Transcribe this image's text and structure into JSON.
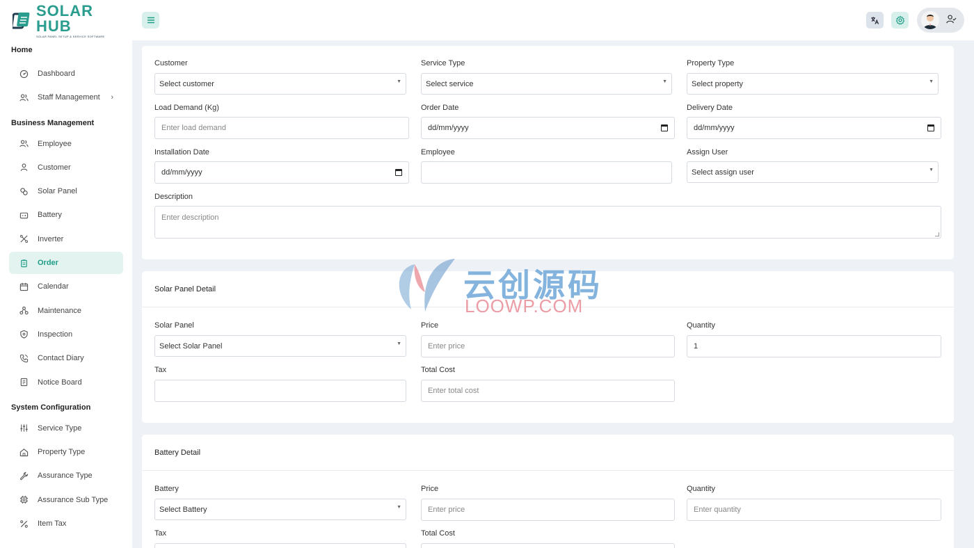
{
  "brand": {
    "name": "SOLAR HUB",
    "tagline": "SOLAR PANEL SETUP & SERVICE SOFTWARE",
    "color": "#2a9d8f"
  },
  "sidebar": {
    "sections": [
      {
        "title": "Home",
        "items": [
          {
            "label": "Dashboard",
            "icon": "dashboard-icon"
          },
          {
            "label": "Staff Management",
            "icon": "users-icon",
            "chevron": "›"
          }
        ]
      },
      {
        "title": "Business Management",
        "items": [
          {
            "label": "Employee",
            "icon": "users-icon"
          },
          {
            "label": "Customer",
            "icon": "user-icon"
          },
          {
            "label": "Solar Panel",
            "icon": "solar-panel-icon"
          },
          {
            "label": "Battery",
            "icon": "battery-icon"
          },
          {
            "label": "Inverter",
            "icon": "inverter-icon"
          },
          {
            "label": "Order",
            "icon": "clipboard-icon",
            "active": true
          },
          {
            "label": "Calendar",
            "icon": "calendar-icon"
          },
          {
            "label": "Maintenance",
            "icon": "maintenance-icon"
          },
          {
            "label": "Inspection",
            "icon": "shield-icon"
          },
          {
            "label": "Contact Diary",
            "icon": "phone-icon"
          },
          {
            "label": "Notice Board",
            "icon": "notice-icon"
          }
        ]
      },
      {
        "title": "System Configuration",
        "items": [
          {
            "label": "Service Type",
            "icon": "sliders-icon"
          },
          {
            "label": "Property Type",
            "icon": "home-icon"
          },
          {
            "label": "Assurance Type",
            "icon": "wrench-icon"
          },
          {
            "label": "Assurance Sub Type",
            "icon": "chip-icon"
          },
          {
            "label": "Item Tax",
            "icon": "percent-icon"
          }
        ]
      }
    ]
  },
  "order_form": {
    "customer": {
      "label": "Customer",
      "value": "Select customer"
    },
    "service_type": {
      "label": "Service Type",
      "value": "Select service"
    },
    "property_type": {
      "label": "Property Type",
      "value": "Select property"
    },
    "load_demand": {
      "label": "Load Demand (Kg)",
      "placeholder": "Enter load demand"
    },
    "order_date": {
      "label": "Order Date",
      "value": "dd/mm/yyyy"
    },
    "delivery_date": {
      "label": "Delivery Date",
      "value": "dd/mm/yyyy"
    },
    "installation_date": {
      "label": "Installation Date",
      "value": "dd/mm/yyyy"
    },
    "employee": {
      "label": "Employee",
      "value": ""
    },
    "assign_user": {
      "label": "Assign User",
      "value": "Select assign user"
    },
    "description": {
      "label": "Description",
      "placeholder": "Enter description"
    }
  },
  "solar_panel_detail": {
    "title": "Solar Panel Detail",
    "solar_panel": {
      "label": "Solar Panel",
      "value": "Select Solar Panel"
    },
    "price": {
      "label": "Price",
      "placeholder": "Enter price"
    },
    "quantity": {
      "label": "Quantity",
      "value": "1"
    },
    "tax": {
      "label": "Tax",
      "value": ""
    },
    "total_cost": {
      "label": "Total Cost",
      "placeholder": "Enter total cost"
    }
  },
  "battery_detail": {
    "title": "Battery Detail",
    "battery": {
      "label": "Battery",
      "value": "Select Battery"
    },
    "price": {
      "label": "Price",
      "placeholder": "Enter price"
    },
    "quantity": {
      "label": "Quantity",
      "placeholder": "Enter quantity"
    },
    "tax": {
      "label": "Tax"
    },
    "total_cost": {
      "label": "Total Cost"
    }
  },
  "watermark": {
    "text": "云创源码",
    "sub": "LOOWP.COM"
  }
}
